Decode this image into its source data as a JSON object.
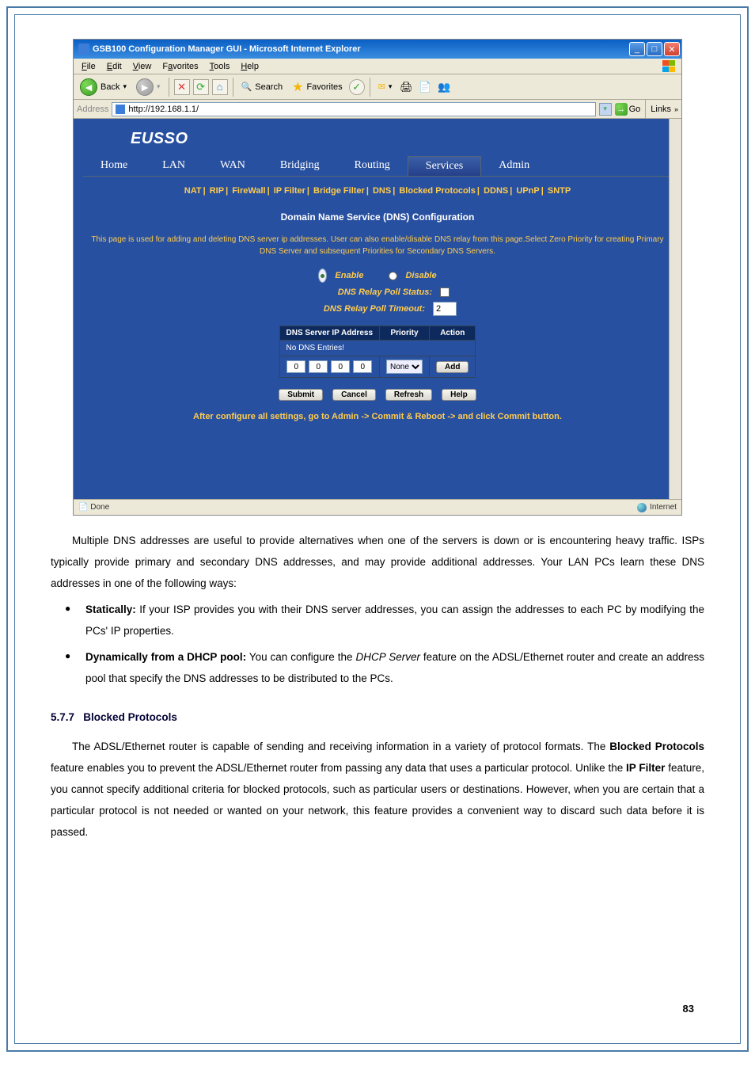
{
  "browser": {
    "title": "GSB100 Configuration Manager GUI - Microsoft Internet Explorer",
    "menus": {
      "file": "File",
      "edit": "Edit",
      "view": "View",
      "favorites": "Favorites",
      "tools": "Tools",
      "help": "Help"
    },
    "tb": {
      "back": "Back",
      "search": "Search",
      "favorites": "Favorites"
    },
    "addr": {
      "label": "Address",
      "url": "http://192.168.1.1/",
      "go": "Go",
      "links": "Links"
    },
    "status": {
      "done": "Done",
      "zone": "Internet"
    }
  },
  "logo": "EUSSO",
  "nav": {
    "home": "Home",
    "lan": "LAN",
    "wan": "WAN",
    "bridging": "Bridging",
    "routing": "Routing",
    "services": "Services",
    "admin": "Admin"
  },
  "subnav": {
    "nat": "NAT",
    "rip": "RIP",
    "firewall": "FireWall",
    "ipfilter": "IP Filter",
    "bridge": "Bridge Filter",
    "dns": "DNS",
    "blocked": "Blocked Protocols",
    "ddns": "DDNS",
    "upnp": "UPnP",
    "sntp": "SNTP"
  },
  "section_title": "Domain Name Service (DNS) Configuration",
  "intro": "This page is used for adding and deleting DNS server ip addresses. User can also enable/disable DNS relay from this page.Select Zero Priority for creating Primary DNS Server and subsequent Priorities for Secondary DNS Servers.",
  "cfg": {
    "enable": "Enable",
    "disable": "Disable",
    "poll_status_label": "DNS Relay Poll Status:",
    "poll_timeout_label": "DNS Relay Poll Timeout:",
    "poll_timeout_value": "2"
  },
  "table": {
    "h1": "DNS Server IP Address",
    "h2": "Priority",
    "h3": "Action",
    "no_entries": "No DNS Entries!",
    "ip1": "0",
    "ip2": "0",
    "ip3": "0",
    "ip4": "0",
    "priority_sel": "None",
    "add": "Add"
  },
  "buttons": {
    "submit": "Submit",
    "cancel": "Cancel",
    "refresh": "Refresh",
    "help": "Help"
  },
  "footer_msg": "After configure all settings, go to Admin -> Commit & Reboot -> and click Commit button.",
  "doc": {
    "p1": "Multiple DNS addresses are useful to provide alternatives when one of the servers is down or is encountering heavy traffic. ISPs typically provide primary and secondary DNS addresses, and may provide additional addresses. Your LAN PCs learn these DNS addresses in one of the following ways:",
    "b1_label": "Statically:",
    "b1_text": " If your ISP provides you with their DNS server addresses, you can assign the addresses to each PC by modifying the PCs' IP properties.",
    "b2_label": "Dynamically from a DHCP pool:",
    "b2_text_a": " You can configure the ",
    "b2_em": "DHCP Server",
    "b2_text_b": " feature on the ADSL/Ethernet router and create an address pool that specify the DNS addresses to be distributed to the PCs.",
    "h_num": "5.7.7",
    "h_title": "Blocked Protocols",
    "p2a": "The ADSL/Ethernet router is capable of sending and receiving information in a variety of protocol formats. The ",
    "p2b": "Blocked Protocols",
    "p2c": " feature enables you to prevent the ADSL/Ethernet router from passing any data that uses a particular protocol. Unlike the ",
    "p2d": "IP Filter",
    "p2e": " feature, you cannot specify additional criteria for blocked protocols, such as particular users or destinations. However, when you are certain that a particular protocol is not needed or wanted on your network, this feature provides a convenient way to discard such data before it is passed."
  },
  "page_number": "83"
}
